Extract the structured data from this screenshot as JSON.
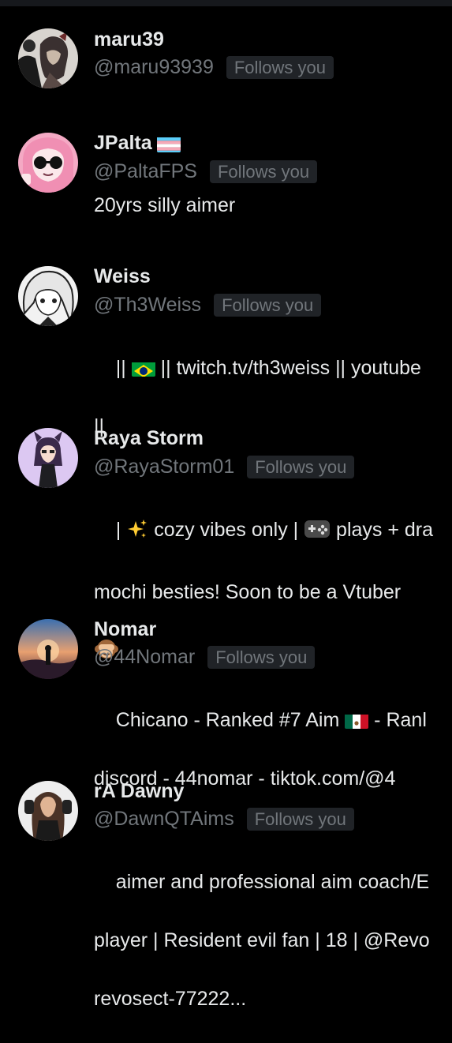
{
  "follows_label": "Follows you",
  "users": [
    {
      "name": "maru39",
      "handle": "@maru93939",
      "bio_lines": []
    },
    {
      "name": "JPalta",
      "name_flag_icon": "transgender-flag-icon",
      "handle": "@PaltaFPS",
      "bio_lines": [
        "20yrs silly aimer"
      ]
    },
    {
      "name": "Weiss",
      "handle": "@Th3Weiss",
      "bio_prefix": "|| ",
      "bio_flag_icon": "brazil-flag-icon",
      "bio_suffix": " || twitch.tv/th3weiss || youtube",
      "bio_line2": "||"
    },
    {
      "name": "Raya Storm",
      "handle": "@RayaStorm01",
      "bio_a": "| ",
      "bio_sparkle_icon": "sparkles-emoji-icon",
      "bio_b": " cozy vibes only | ",
      "bio_controller_icon": "game-controller-emoji-icon",
      "bio_c": " plays + dra",
      "bio_line2": "mochi besties! Soon to be a Vtuber",
      "bio_monkey_icon": "see-no-evil-monkey-emoji-icon"
    },
    {
      "name": "Nomar",
      "handle": "@44Nomar",
      "bio_a": "Chicano - Ranked #7 Aim ",
      "bio_flag_icon": "mexico-flag-icon",
      "bio_b": " - Ranl",
      "bio_line2": "discord - 44nomar - tiktok.com/@4"
    },
    {
      "name": "rA Dawny",
      "handle": "@DawnQTAims",
      "bio_lines": [
        "aimer and professional aim coach/E",
        "player | Resident evil fan | 18 | @Revo",
        "revosect-77222..."
      ]
    }
  ]
}
